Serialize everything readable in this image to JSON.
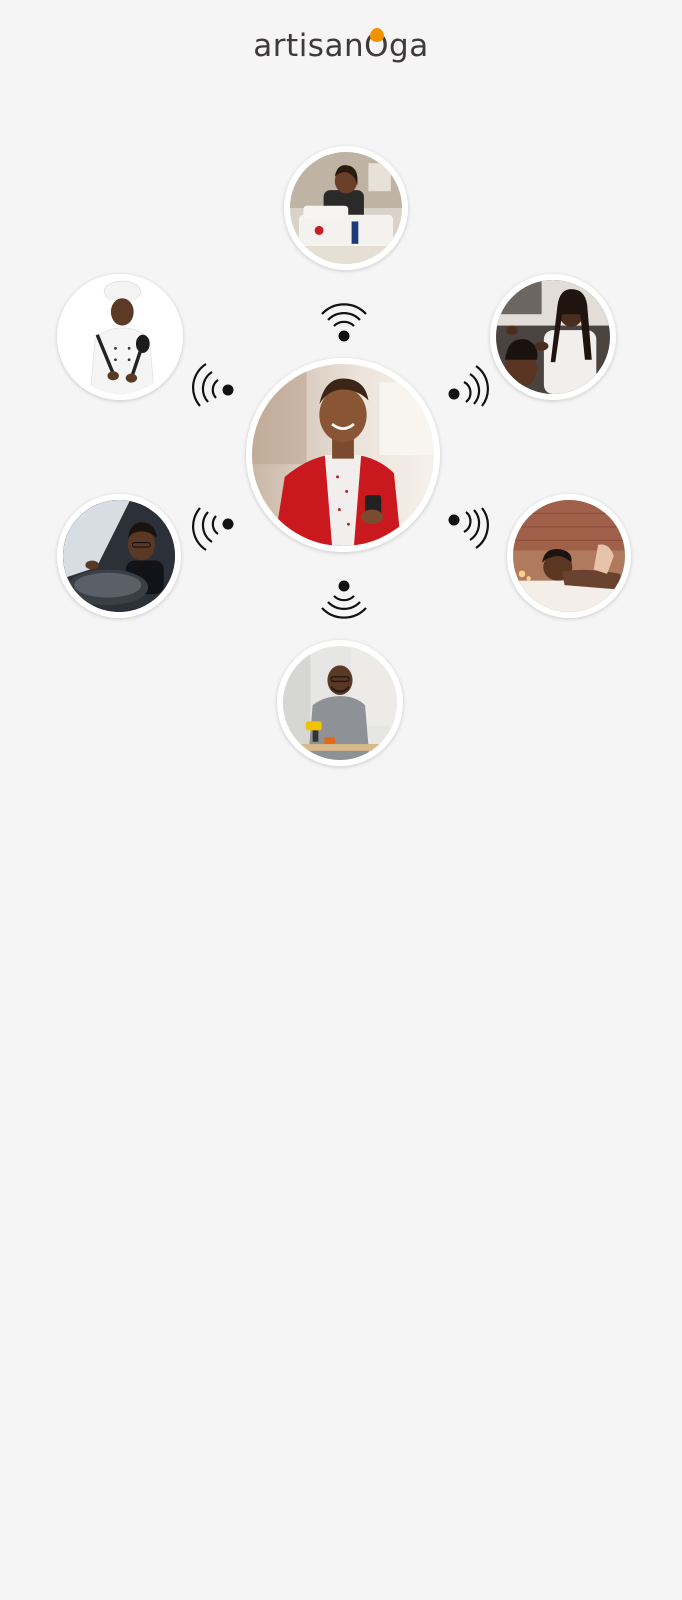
{
  "brand": {
    "logo_part_a": "artisan",
    "logo_o": "O",
    "logo_part_b": "ga",
    "text_color": "#3e3a39",
    "accent_color": "#f39200"
  },
  "page": {
    "background": "#f5f5f5"
  },
  "avatars": [
    {
      "id": "center",
      "subject": "customer-with-phone"
    },
    {
      "id": "top",
      "subject": "tailor-at-sewing-machine"
    },
    {
      "id": "top-left",
      "subject": "chef"
    },
    {
      "id": "top-right",
      "subject": "hair-braider"
    },
    {
      "id": "bottom-left",
      "subject": "driver"
    },
    {
      "id": "bottom-right",
      "subject": "spa-massage"
    },
    {
      "id": "bottom",
      "subject": "carpenter"
    }
  ],
  "icons": {
    "signal": "wifi-signal-icon"
  }
}
